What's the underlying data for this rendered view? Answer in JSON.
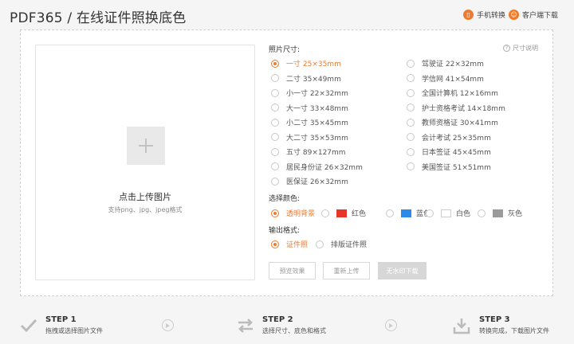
{
  "header": {
    "title": "PDF365 / 在线证件照换底色",
    "mobile_link": "手机转换",
    "download_link": "客户端下载"
  },
  "upload": {
    "title": "点击上传图片",
    "hint": "支持png、jpg、jpeg格式"
  },
  "size": {
    "label": "照片尺寸:",
    "help": "尺寸说明",
    "options_left": [
      {
        "label": "一寸 25×35mm",
        "selected": true
      },
      {
        "label": "二寸 35×49mm",
        "selected": false
      },
      {
        "label": "小一寸 22×32mm",
        "selected": false
      },
      {
        "label": "大一寸 33×48mm",
        "selected": false
      },
      {
        "label": "小二寸 35×45mm",
        "selected": false
      },
      {
        "label": "大二寸 35×53mm",
        "selected": false
      },
      {
        "label": "五寸 89×127mm",
        "selected": false
      },
      {
        "label": "居民身份证 26×32mm",
        "selected": false
      },
      {
        "label": "医保证 26×32mm",
        "selected": false
      }
    ],
    "options_right": [
      {
        "label": "驾驶证 22×32mm",
        "selected": false
      },
      {
        "label": "学信网 41×54mm",
        "selected": false
      },
      {
        "label": "全国计算机 12×16mm",
        "selected": false
      },
      {
        "label": "护士资格考试 14×18mm",
        "selected": false
      },
      {
        "label": "教师资格证 30×41mm",
        "selected": false
      },
      {
        "label": "会计考试 25×35mm",
        "selected": false
      },
      {
        "label": "日本签证 45×45mm",
        "selected": false
      },
      {
        "label": "美国签证 51×51mm",
        "selected": false
      }
    ]
  },
  "color": {
    "label": "选择颜色:",
    "options": [
      {
        "label": "透明背景",
        "selected": true,
        "swatch": ""
      },
      {
        "label": "红色",
        "selected": false,
        "swatch": "#e8352a"
      },
      {
        "label": "蓝色",
        "selected": false,
        "swatch": "#2a8ce8"
      },
      {
        "label": "白色",
        "selected": false,
        "swatch": "#ffffff"
      },
      {
        "label": "灰色",
        "selected": false,
        "swatch": "#9b9b9b"
      }
    ]
  },
  "format": {
    "label": "输出格式:",
    "options": [
      {
        "label": "证件照",
        "selected": true
      },
      {
        "label": "排版证件照",
        "selected": false
      }
    ]
  },
  "actions": {
    "preview": "预览效果",
    "reupload": "重新上传",
    "download": "无水印下载"
  },
  "steps": [
    {
      "title": "STEP 1",
      "desc": "拖拽或选择图片文件",
      "icon": "check-icon"
    },
    {
      "title": "STEP 2",
      "desc": "选择尺寸、底色和格式",
      "icon": "swap-arrows-icon"
    },
    {
      "title": "STEP 3",
      "desc": "转换完成，下载图片文件",
      "icon": "download-tray-icon"
    }
  ],
  "colors": {
    "accent": "#f07a2c"
  }
}
